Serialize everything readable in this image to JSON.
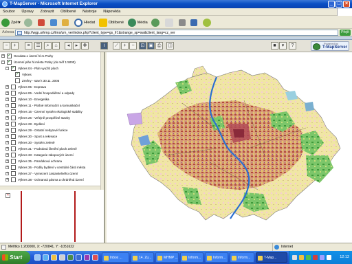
{
  "window": {
    "title": "T-MapServer - Microsoft Internet Explorer"
  },
  "menu": {
    "items": [
      "Soubor",
      "Úpravy",
      "Zobrazit",
      "Oblíbené",
      "Nástroje",
      "Nápověda"
    ]
  },
  "toolbar": {
    "back": "Zpět",
    "search": "Hledat",
    "favorites": "Oblíbené",
    "media": "Média"
  },
  "address": {
    "label": "Adresa",
    "url": "http://wgp.urhmp.cz/tms/um_ver/index.php?client_type=gs_fr1&strange_sp=sw&client_lang=cz_ver",
    "go_label": "Přejít"
  },
  "brand": {
    "powered_by": "Powered by",
    "name": "T-MapServer"
  },
  "layers": [
    {
      "label": "Geodata o území hl.m.Prahy",
      "expander": "+",
      "checked": true
    },
    {
      "label": "Územní plán hl.města Prahy (do měř 1:5000)",
      "expander": "−",
      "checked": true
    },
    {
      "label": "Výkres 04 - Plán využití ploch",
      "expander": "−",
      "checked": true
    },
    {
      "label": "Výkres",
      "expander": "",
      "checked": true
    },
    {
      "label": "Změny - stav k 30.11. 2005",
      "expander": "",
      "checked": false
    },
    {
      "label": "Výkres 05 - Doprava",
      "expander": "+",
      "checked": false
    },
    {
      "label": "Výkres 06 - Vodní hospodářství a odpady",
      "expander": "+",
      "checked": false
    },
    {
      "label": "Výkres 10 - Energetika",
      "expander": "+",
      "checked": false
    },
    {
      "label": "Výkres 11 - Plošné informační a komunikační",
      "expander": "+",
      "checked": false
    },
    {
      "label": "Výkres 16 - Územní systém ekologické stability",
      "expander": "+",
      "checked": false
    },
    {
      "label": "Výkres 26 - Veřejně prospěšné stavby",
      "expander": "+",
      "checked": false
    },
    {
      "label": "Výkres 28 - Bydlení",
      "expander": "+",
      "checked": false
    },
    {
      "label": "Výkres 29 - Ostatní nebytové funkce",
      "expander": "+",
      "checked": false
    },
    {
      "label": "Výkres 30 - Sport a rekreace",
      "expander": "+",
      "checked": false
    },
    {
      "label": "Výkres 30 - Systém zeleně",
      "expander": "+",
      "checked": false
    },
    {
      "label": "Výkres 31 - Podrobná členění ploch zeleně",
      "expander": "+",
      "checked": false
    },
    {
      "label": "Výkres 33 - Kategorie zátopových území",
      "expander": "+",
      "checked": false
    },
    {
      "label": "Výkres 35 - Památková ochrana",
      "expander": "+",
      "checked": false
    },
    {
      "label": "Výkres 36 - Podíly bydlení v centrální části města",
      "expander": "+",
      "checked": false
    },
    {
      "label": "Výkres 37 - Vymezení zastavitelného území",
      "expander": "+",
      "checked": false
    },
    {
      "label": "Výkres 38 - Ochranná pásma a chráněná území",
      "expander": "+",
      "checked": false
    }
  ],
  "status": {
    "text": "Měřítko 1:200000, X: -720841, Y: -1051622",
    "zone": "Internet"
  },
  "taskbar": {
    "start": "Start",
    "tasks": [
      {
        "label": "Inbox ...",
        "active": false
      },
      {
        "label": "14. Zu...",
        "active": false
      },
      {
        "label": "MHMP ...",
        "active": false
      },
      {
        "label": "Inform...",
        "active": false
      },
      {
        "label": "Inform...",
        "active": false
      },
      {
        "label": "Inform...",
        "active": false
      },
      {
        "label": "T-Map...",
        "active": true
      }
    ],
    "clock": "12:12"
  }
}
